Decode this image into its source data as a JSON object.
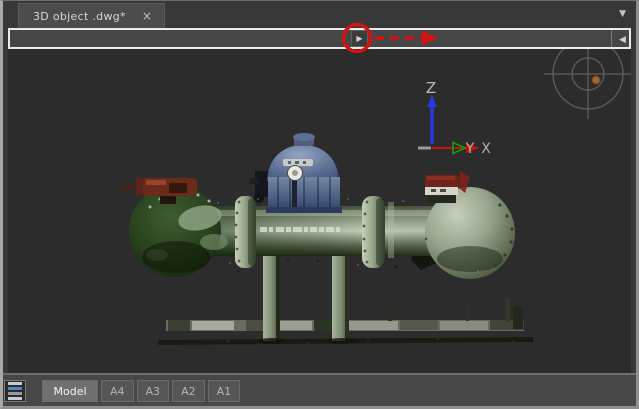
{
  "window": {
    "document_tab": {
      "title": "3D object .dwg*",
      "close_icon": "×"
    },
    "menu_dropdown_icon": "▼"
  },
  "ribbon": {
    "expand_button_icon": "▶",
    "collapse_button_icon": "◀"
  },
  "annotation": {
    "description": "red circle highlighting ribbon expand button with dashed arrow pointing right",
    "color": "#d01414"
  },
  "viewport": {
    "background_color": "#2c2c2c",
    "model_description": "point cloud scan of green industrial pipe manifold with blue valve actuator, red hand valves, two support legs",
    "ucs_icon": {
      "z_label": "Z",
      "y_label": "Y",
      "x_label": "X",
      "z_axis_color": "#2a3ae0",
      "y_axis_color": "#10a010",
      "x_axis_color": "#c81408",
      "label_color": "#bdbdbd"
    },
    "orbit_compass": {
      "line_color": "#5e5e5e",
      "dot_color": "#a5642e"
    }
  },
  "layout_bar": {
    "quick_view_button": "layout-list",
    "tabs": [
      {
        "label": "Model",
        "active": true
      },
      {
        "label": "A4",
        "active": false
      },
      {
        "label": "A3",
        "active": false
      },
      {
        "label": "A2",
        "active": false
      },
      {
        "label": "A1",
        "active": false
      }
    ]
  }
}
